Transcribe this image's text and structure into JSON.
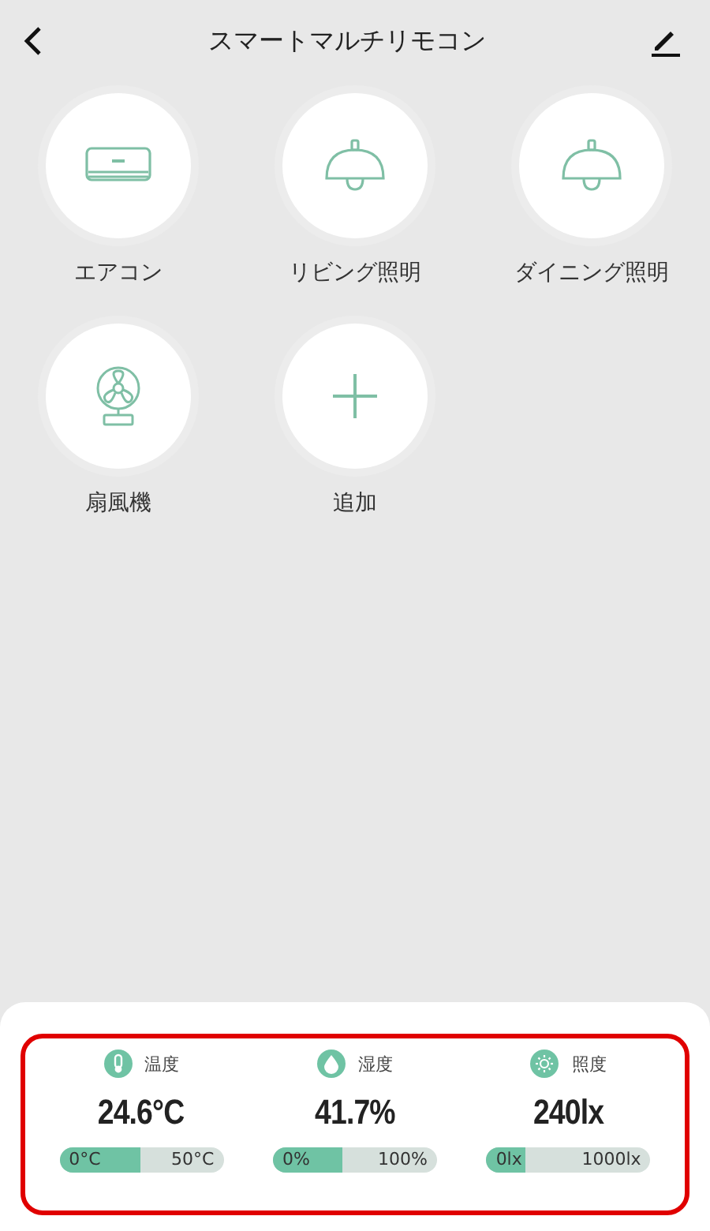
{
  "header": {
    "title": "スマートマルチリモコン"
  },
  "devices": [
    {
      "kind": "aircon",
      "label": "エアコン"
    },
    {
      "kind": "lamp",
      "label": "リビング照明"
    },
    {
      "kind": "lamp",
      "label": "ダイニング照明"
    },
    {
      "kind": "fan",
      "label": "扇風機"
    },
    {
      "kind": "add",
      "label": "追加"
    }
  ],
  "sensors": [
    {
      "kind": "temperature",
      "label": "温度",
      "value": "24.6°C",
      "min": "0°C",
      "max": "50°C",
      "level": 0.49
    },
    {
      "kind": "humidity",
      "label": "湿度",
      "value": "41.7%",
      "min": "0%",
      "max": "100%",
      "level": 0.42
    },
    {
      "kind": "illuminance",
      "label": "照度",
      "value": "240lx",
      "min": "0lx",
      "max": "1000lx",
      "level": 0.24
    }
  ]
}
